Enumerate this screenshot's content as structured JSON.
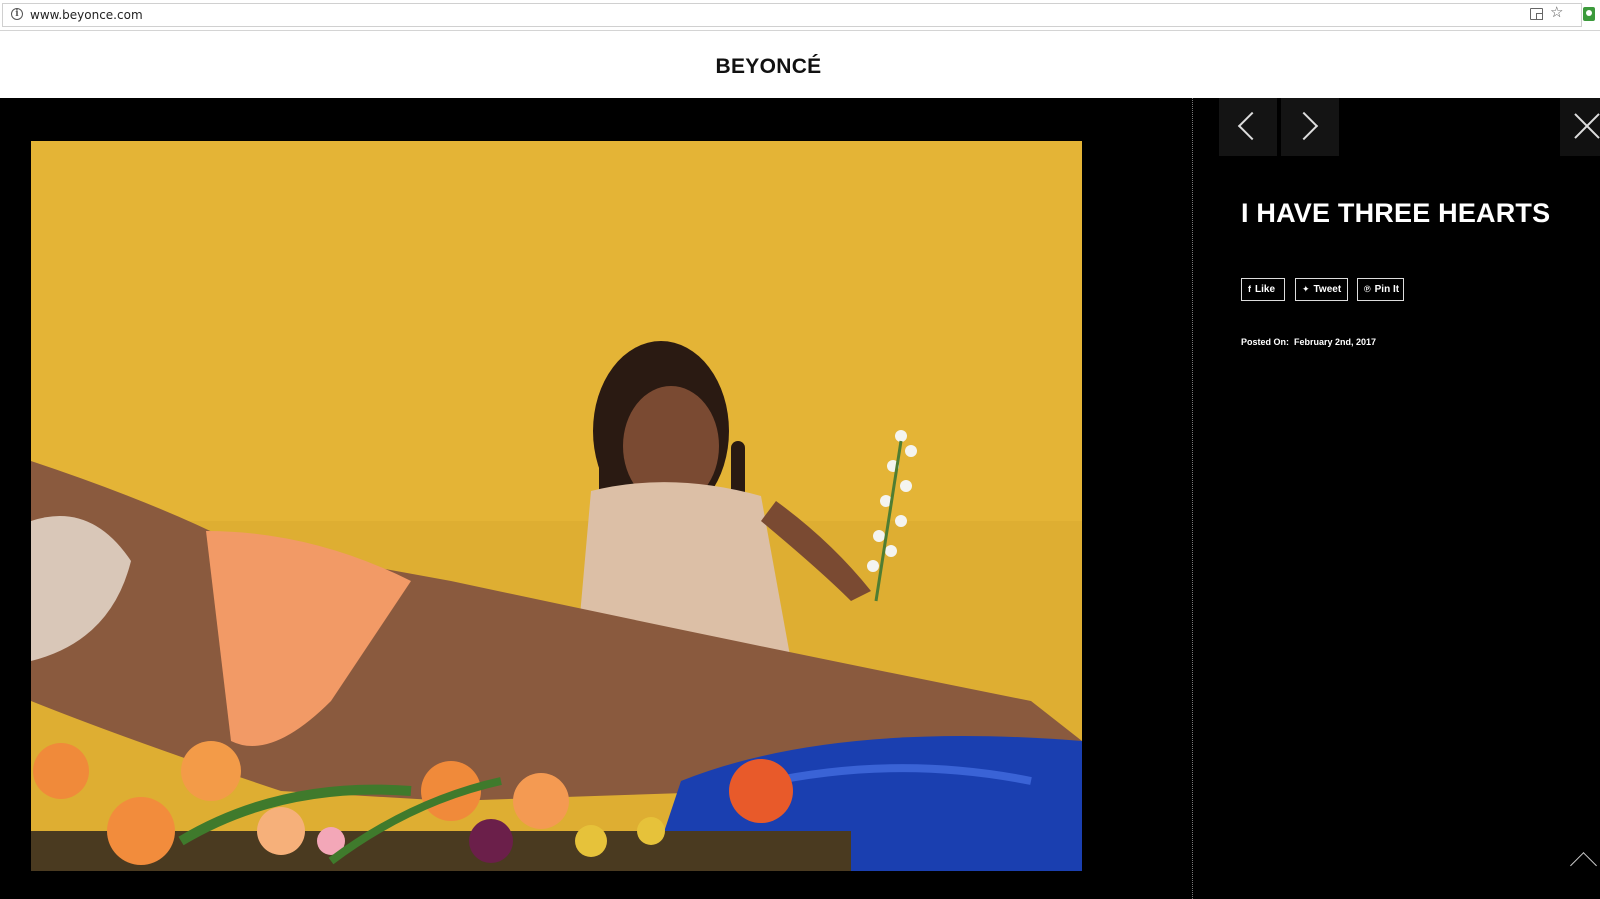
{
  "browser": {
    "url": "www.beyonce.com",
    "info_icon": "info-icon",
    "translate_icon": "translate-icon",
    "bookmark_icon": "star-icon",
    "extension_icon": "extension-icon"
  },
  "site": {
    "logo": "BEYONCÉ"
  },
  "lightbox": {
    "prev_icon": "chevron-left-icon",
    "next_icon": "chevron-right-icon",
    "close_icon": "close-icon",
    "image_alt": "Pregnant woman reclining on flowers with a young girl holding white flowers against a yellow backdrop",
    "title": "I HAVE THREE HEARTS",
    "share": {
      "like": "Like",
      "tweet": "Tweet",
      "pin": "Pin It"
    },
    "posted_label": "Posted On:",
    "posted_date": "February 2nd, 2017",
    "scroll_top_icon": "chevron-up-icon"
  },
  "colors": {
    "lightbox_bg": "#000000",
    "photo_backdrop": "#e3b233",
    "text": "#ffffff"
  }
}
